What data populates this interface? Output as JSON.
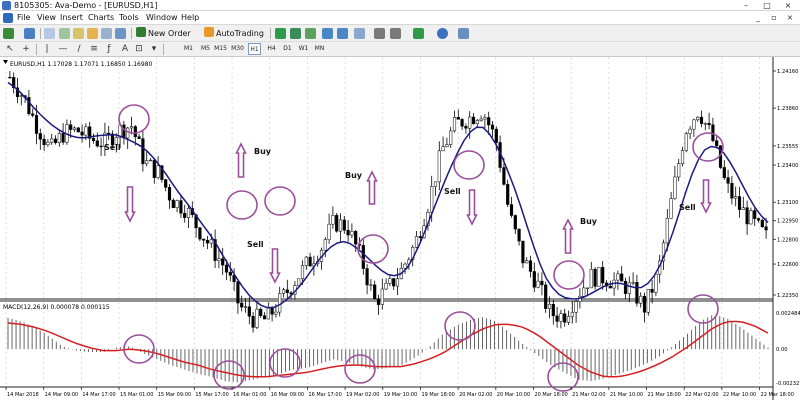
{
  "window": {
    "title": "8105305: Ava-Demo - [EURUSD,H1]",
    "controls": [
      "–",
      "□",
      "×"
    ]
  },
  "menu": {
    "items": [
      "File",
      "View",
      "Insert",
      "Charts",
      "Tools",
      "Window",
      "Help"
    ],
    "mdi_controls": [
      "_",
      "▫",
      "×"
    ]
  },
  "toolbar": {
    "new_order_label": "New Order",
    "autotrading_label": "AutoTrading",
    "timeframes": [
      "M1",
      "M5",
      "M15",
      "M30",
      "H1",
      "H4",
      "D1",
      "W1",
      "MN"
    ]
  },
  "colors": {
    "background": "#ffffff",
    "candle": "#000000",
    "moving_average": "#1a1a80",
    "signal_line": "#d42020",
    "annotation": "#9b4e9b",
    "bull_candle_body": "#ffffff",
    "bear_candle_body": "#000000"
  },
  "chart_data": [
    {
      "type": "candlestick",
      "title": "EURUSD,H1  1.17028 1.17071 1.16850 1.16980",
      "symbol": "EURUSD,H1",
      "ohlc_header": [
        "1.17028",
        "1.17071",
        "1.16850",
        "1.16980"
      ],
      "y_ticks": [
        "1.24160",
        "1.23860",
        "1.23555",
        "1.23400",
        "1.23100",
        "1.22950",
        "1.22800",
        "1.22600",
        "1.22350"
      ],
      "ylim": [
        1.2235,
        1.2416
      ],
      "overlay": "moving average",
      "approx_close_values": [
        1.2411,
        1.2395,
        1.2372,
        1.2352,
        1.2366,
        1.2368,
        1.2361,
        1.2358,
        1.2368,
        1.2372,
        1.2342,
        1.2334,
        1.2312,
        1.2305,
        1.2288,
        1.2272,
        1.2256,
        1.2226,
        1.2216,
        1.2215,
        1.223,
        1.2245,
        1.226,
        1.2272,
        1.2294,
        1.229,
        1.2265,
        1.223,
        1.224,
        1.2255,
        1.2276,
        1.231,
        1.2352,
        1.2373,
        1.2378,
        1.2384,
        1.236,
        1.23,
        1.2264,
        1.2246,
        1.222,
        1.2218,
        1.2235,
        1.225,
        1.2249,
        1.2245,
        1.224,
        1.2225,
        1.2252,
        1.2312,
        1.2368,
        1.2385,
        1.2362,
        1.2324,
        1.2306,
        1.2294,
        1.2282
      ],
      "annotations": [
        {
          "label": "Sell",
          "arrow": "down"
        },
        {
          "label": "Buy",
          "arrow": "up"
        },
        {
          "label": "Sell",
          "arrow": "down"
        },
        {
          "label": "Buy",
          "arrow": "up"
        },
        {
          "label": "Sell",
          "arrow": "down"
        },
        {
          "label": "Buy",
          "arrow": "up"
        },
        {
          "label": "Sell",
          "arrow": "down"
        }
      ]
    },
    {
      "type": "histogram",
      "title": "MACD(12,26,9) 0.000078 0.000115",
      "indicator": "MACD(12,26,9)",
      "values_header": [
        "0.000078",
        "0.000115"
      ],
      "y_ticks": [
        "0.002484",
        "0.00",
        "-0.002327"
      ],
      "ylim": [
        -0.002327,
        0.002484
      ],
      "series": [
        {
          "name": "MACD",
          "values": [
            0.00215,
            0.0019,
            0.0015,
            0.0009,
            0.0002,
            -0.0001,
            -0.0002,
            -0.0002,
            0.0001,
            0.0002,
            -0.0003,
            -0.0007,
            -0.0011,
            -0.0014,
            -0.0017,
            -0.0019,
            -0.0022,
            -0.0023,
            -0.0021,
            -0.0019,
            -0.0017,
            -0.0014,
            -0.0013,
            -0.001,
            -0.0007,
            -0.0009,
            -0.0012,
            -0.0014,
            -0.0013,
            -0.0011,
            -0.0006,
            0.0001,
            0.001,
            0.0016,
            0.002,
            0.0022,
            0.0019,
            0.0011,
            0.0003,
            -0.0004,
            -0.0011,
            -0.0016,
            -0.0021,
            -0.0022,
            -0.002,
            -0.0017,
            -0.0014,
            -0.001,
            -0.0005,
            0.0002,
            0.001,
            0.0019,
            0.0024,
            0.0021,
            0.0015,
            0.0008,
            0.0001
          ]
        },
        {
          "name": "Signal",
          "values": [
            0.0018,
            0.0017,
            0.0015,
            0.0012,
            0.0008,
            0.0004,
            0.0001,
            -0.0001,
            -0.0001,
            0.0,
            -0.0001,
            -0.0003,
            -0.0006,
            -0.0009,
            -0.0011,
            -0.0014,
            -0.0016,
            -0.0018,
            -0.0019,
            -0.0019,
            -0.0018,
            -0.0017,
            -0.0016,
            -0.0014,
            -0.0012,
            -0.0011,
            -0.0011,
            -0.0012,
            -0.0012,
            -0.0012,
            -0.001,
            -0.0007,
            -0.0003,
            0.0003,
            0.0009,
            0.0014,
            0.0017,
            0.0017,
            0.0015,
            0.001,
            0.0003,
            -0.0004,
            -0.0011,
            -0.0016,
            -0.0019,
            -0.0019,
            -0.0017,
            -0.0014,
            -0.001,
            -0.0005,
            0.0001,
            0.0008,
            0.0015,
            0.0019,
            0.0019,
            0.0016,
            0.0011
          ]
        }
      ],
      "x_ticks": [
        "14 Mar 2018",
        "14 Mar 09:00",
        "14 Mar 17:00",
        "15 Mar 01:00",
        "15 Mar 09:00",
        "15 Mar 17:00",
        "16 Mar 01:00",
        "16 Mar 09:00",
        "16 Mar 17:00",
        "19 Mar 02:00",
        "19 Mar 10:00",
        "19 Mar 18:00",
        "20 Mar 02:00",
        "20 Mar 10:00",
        "20 Mar 18:00",
        "21 Mar 02:00",
        "21 Mar 10:00",
        "21 Mar 18:00",
        "22 Mar 02:00",
        "22 Mar 10:00",
        "22 Mar 18:00"
      ]
    }
  ]
}
